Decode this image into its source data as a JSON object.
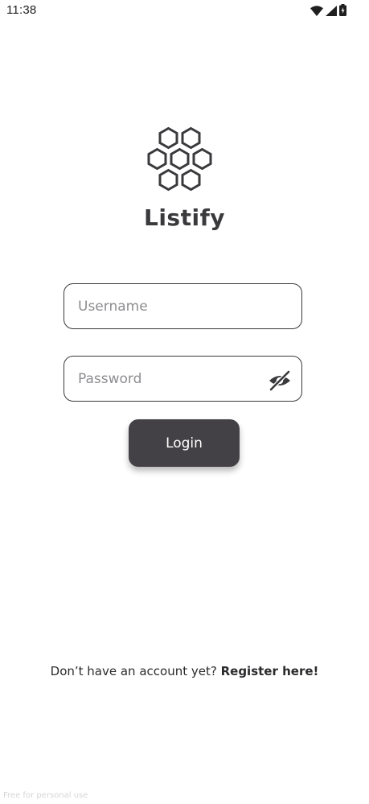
{
  "status_bar": {
    "time": "11:38",
    "icons": [
      "wifi-icon",
      "signal-icon",
      "battery-icon"
    ]
  },
  "app": {
    "logo": "hexagon-cluster-logo",
    "name": "Listify"
  },
  "login_form": {
    "username_placeholder": "Username",
    "username_value": "",
    "password_placeholder": "Password",
    "password_value": "",
    "password_toggle_icon": "eye-off-icon",
    "login_label": "Login"
  },
  "register": {
    "prompt": "Don’t have an account yet?",
    "link_label": "Register here!"
  },
  "watermark": "Free for personal use",
  "colors": {
    "primary_dark": "#434145",
    "text": "#2b2a2d",
    "placeholder": "#8d8c8f",
    "background": "#ffffff"
  }
}
